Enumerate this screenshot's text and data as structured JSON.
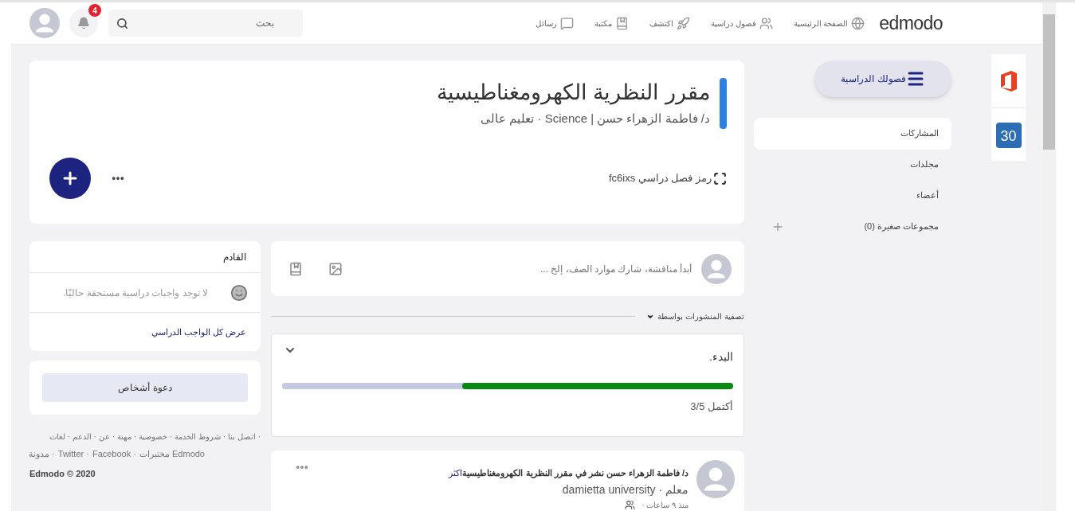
{
  "topbar": {
    "logo": "edmodo",
    "nav": [
      {
        "label": "الصفحة الرئيسية",
        "kind": "home"
      },
      {
        "label": "فصول دراسية",
        "kind": "classes"
      },
      {
        "label": "اكتشف",
        "kind": "discover"
      },
      {
        "label": "مكتبة",
        "kind": "library"
      },
      {
        "label": "رسائل",
        "kind": "messages"
      }
    ],
    "search": {
      "placeholder": "بحث"
    },
    "notifications": {
      "count": "4"
    }
  },
  "class_header": {
    "title": "مقرر النظرية الكهرومغناطيسية",
    "subtitle": "د/ فاطمة الزهراء حسن | Science · تعليم عالى",
    "class_code": "رمز فصل دراسي fc6ixs"
  },
  "sidebar": {
    "classes_button": "فصولك الدراسية",
    "items": [
      {
        "label": "المشاركات",
        "selected": true,
        "kind": "link"
      },
      {
        "label": "مجلدات",
        "selected": false,
        "kind": "link"
      },
      {
        "label": "أعضاء",
        "selected": false,
        "kind": "link"
      },
      {
        "label": "مجموعات صغيرة (0)",
        "selected": false,
        "kind": "add"
      }
    ]
  },
  "apps": {
    "calendar_day": "30"
  },
  "upcoming": {
    "title": "القادم",
    "empty_message": "لا توجد واجبات دراسية مستحقة حاليًا.",
    "link": "عرض كل الواجب الدراسي"
  },
  "invite_button": "دعوة أشخاص",
  "footer": {
    "links_row_1": [
      "· اتصل بنا",
      "· شروط الخدمة",
      "· خصوصية",
      "· مهنة",
      "· عن",
      "· الدعم",
      "· لغات"
    ],
    "links_row_2": [
      "Edmodo مختبرات",
      "· Facebook",
      "· Twitter",
      "· مدونة"
    ],
    "copyright": "Edmodo © 2020"
  },
  "composer": {
    "placeholder": "أبدأ مناقشة، شارك موارد الصف، إلخ ..."
  },
  "filter": {
    "label": "تصفية المنشورات بواسطة"
  },
  "progress": {
    "title": "البدء.",
    "level": 0.6,
    "reading": "أكتمل 3/5"
  },
  "post": {
    "headline": "د/ فاطمة الزهراء حسن نشر في مقرر النظرية الكهرومغناطيسية",
    "more_link": "اكثر",
    "meta": "معلم · damietta university",
    "time": "منذ ٩ ساعات ·"
  }
}
